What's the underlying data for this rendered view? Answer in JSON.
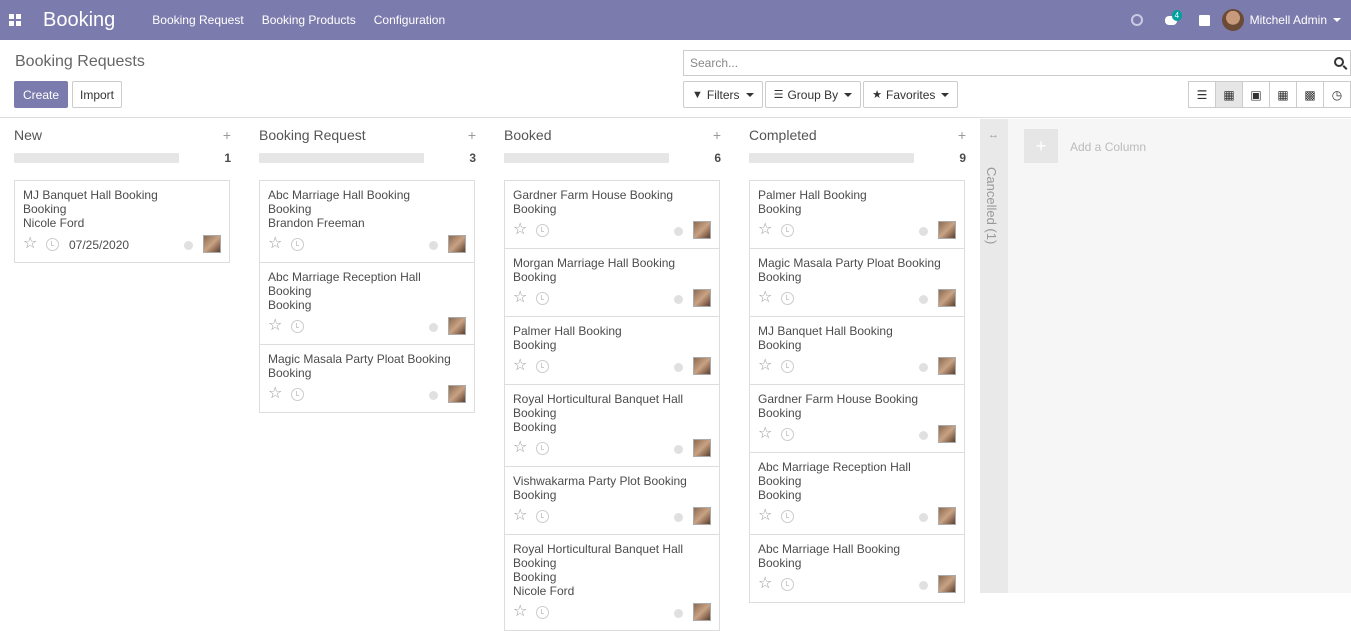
{
  "navbar": {
    "brand": "Booking",
    "menu": [
      "Booking Request",
      "Booking Products",
      "Configuration"
    ],
    "chat_badge": "4",
    "user_name": "Mitchell Admin"
  },
  "control": {
    "breadcrumb": "Booking Requests",
    "create_label": "Create",
    "import_label": "Import",
    "search_placeholder": "Search...",
    "filters_label": "Filters",
    "groupby_label": "Group By",
    "favorites_label": "Favorites"
  },
  "columns": [
    {
      "title": "New",
      "count": "1",
      "cards": [
        {
          "lines": [
            "MJ Banquet Hall Booking",
            "Booking",
            "Nicole Ford"
          ],
          "date": "07/25/2020"
        }
      ]
    },
    {
      "title": "Booking Request",
      "count": "3",
      "cards": [
        {
          "lines": [
            "Abc Marriage Hall Booking",
            "Booking",
            "Brandon Freeman"
          ]
        },
        {
          "lines": [
            "Abc Marriage Reception Hall",
            "Booking",
            "Booking"
          ]
        },
        {
          "lines": [
            "Magic Masala Party Ploat Booking",
            "Booking"
          ]
        }
      ]
    },
    {
      "title": "Booked",
      "count": "6",
      "cards": [
        {
          "lines": [
            "Gardner Farm House Booking",
            "Booking"
          ]
        },
        {
          "lines": [
            "Morgan Marriage Hall Booking",
            "Booking"
          ]
        },
        {
          "lines": [
            "Palmer Hall Booking",
            "Booking"
          ]
        },
        {
          "lines": [
            "Royal Horticultural Banquet Hall",
            "Booking",
            "Booking"
          ]
        },
        {
          "lines": [
            "Vishwakarma Party Plot Booking",
            "Booking"
          ]
        },
        {
          "lines": [
            "Royal Horticultural Banquet Hall",
            "Booking",
            "Booking",
            "Nicole Ford"
          ]
        }
      ]
    },
    {
      "title": "Completed",
      "count": "9",
      "cards": [
        {
          "lines": [
            "Palmer Hall Booking",
            "Booking"
          ]
        },
        {
          "lines": [
            "Magic Masala Party Ploat Booking",
            "Booking"
          ]
        },
        {
          "lines": [
            "MJ Banquet Hall Booking",
            "Booking"
          ]
        },
        {
          "lines": [
            "Gardner Farm House Booking",
            "Booking"
          ]
        },
        {
          "lines": [
            "Abc Marriage Reception Hall",
            "Booking",
            "Booking"
          ]
        },
        {
          "lines": [
            "Abc Marriage Hall Booking",
            "Booking"
          ]
        }
      ]
    }
  ],
  "cancelled_label": "Cancelled (1)",
  "add_column_label": "Add a Column",
  "accent_color": "#7c7bad"
}
